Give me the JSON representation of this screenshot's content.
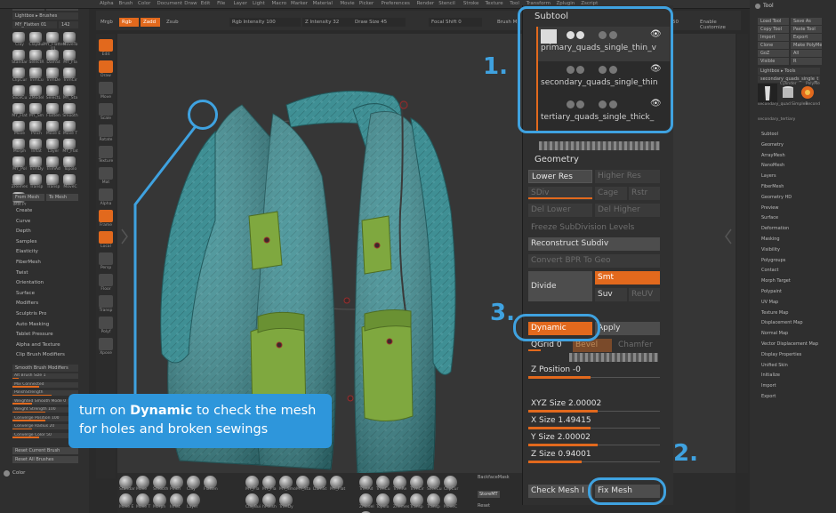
{
  "menu": [
    "Alpha",
    "Brush",
    "Color",
    "Document",
    "Draw",
    "Edit",
    "File",
    "Layer",
    "Light",
    "Macro",
    "Marker",
    "Material",
    "Movie",
    "Picker",
    "Preferences",
    "Render",
    "Stencil",
    "Stroke",
    "Texture",
    "Tool",
    "Transform",
    "Zplugin",
    "Zscript"
  ],
  "params": {
    "mrgb": "Mrgb",
    "rgb": "Rgb",
    "zadd": "Zadd",
    "zsub": "Zsub",
    "rgb_intensity": "Rgb Intensity 100",
    "z_intensity": "Z Intensity 32",
    "draw_size": "Draw Size 45",
    "focal_shift": "Focal Shift 0",
    "brush_label": "Brush M",
    "sculpt_label": "S",
    "active_points": "ActivePoints",
    "total_points": "TotalPoints",
    "sv": "SV 50",
    "enable_customize": "Enable Customize"
  },
  "left_panel": {
    "clone": "Clone",
    "selection": "Selection",
    "lightbox_brushes": "Lightbox ▸ Brushes",
    "current_brush": "MY_Flatten 01",
    "current_brush_num": "142",
    "brushes": [
      "Clay",
      "ClayBui",
      "MY_Flatten 01",
      "MoveTo",
      "Standar",
      "SelectR",
      "DamSt",
      "MY_Fla",
      "ClipCur",
      "TrimCu",
      "TrimDe",
      "TrimCir",
      "SliceCu",
      "ZModel",
      "SelectL",
      "MY_Sta",
      "MY_Flat",
      "MY_Sm",
      "Flatten",
      "Smooth",
      "Move",
      "Pinch",
      "Move E",
      "Move T",
      "Morph",
      "Inflat",
      "Layer",
      "MY_Flat",
      "MY_Pol",
      "TrimDy",
      "TrimAd",
      "Topolo",
      "ZRemes",
      "Transp",
      "Transp",
      "MoveC",
      "IMM Pr"
    ],
    "from_mesh": "From Mesh",
    "to_mesh": "To Mesh",
    "menus": [
      "Create",
      "Curve",
      "Depth",
      "Samples",
      "Elasticity",
      "FiberMesh",
      "Twist",
      "Orientation",
      "Surface",
      "Modifiers",
      "Sculptris Pro",
      "Auto Masking",
      "Tablet Pressure",
      "Alpha and Texture",
      "Clip Brush Modifiers"
    ],
    "smooth_mods_title": "Smooth Brush Modifiers",
    "sliders": [
      "Alt Brush Size 1",
      "Mix Connected",
      "PolishStrength",
      "Weighted Smooth Mode 0",
      "Weight Strength 100",
      "Converge Position 100",
      "Converge Radius 20",
      "Converge Color 50"
    ],
    "reset_current": "Reset Current Brush",
    "reset_all": "Reset All Brushes",
    "color_label": "Color"
  },
  "vtools": [
    "Edit",
    "Draw",
    "Move",
    "Scale",
    "Rotate",
    "Texture",
    "Mat",
    "Alpha",
    "Frame",
    "Local",
    "Persp",
    "Floor",
    "Transp",
    "Polyf",
    "Xpose"
  ],
  "bottom_brushes": [
    "Standar",
    "Move",
    "Smooth",
    "Pinch",
    "Clay",
    "Flatten",
    "Move E",
    "Move T",
    "Morph",
    "Inflat",
    "Layer",
    "MY_Fla",
    "MY_Fla",
    "MY_Smo",
    "MY_Sta",
    "DamSt",
    "MY_Flat",
    "ClayBui",
    "hPolish",
    "TrimDy",
    "TrimAd",
    "TrimCu",
    "TrimRe",
    "TrimCir",
    "SliceCu",
    "ClipCur",
    "ZModel",
    "Topolo",
    "ZRemes",
    "Transp",
    "Transp",
    "MoveC",
    "IMM Pr"
  ],
  "bottom_right": [
    "BackfaceMask",
    "StoreMT",
    "Reset"
  ],
  "right_panel": {
    "tool_title": "Tool",
    "buttons": [
      "Load Tool",
      "Save As",
      "Copy Tool",
      "Paste Tool",
      "Import",
      "Export",
      "Clone",
      "Make PolyMesh3D",
      "GoZ",
      "All",
      "Visible",
      "R"
    ],
    "lightbox_tools": "Lightbox ▸ Tools",
    "current_tool": "secondary_quads_single_t",
    "tools": [
      "secondary_quad",
      "Cylinder",
      "PolyMe",
      "SimpleB",
      "second",
      "second",
      "secondary_tertiary"
    ],
    "menus": [
      "Subtool",
      "Geometry",
      "ArrayMesh",
      "NanoMesh",
      "Layers",
      "FiberMesh",
      "Geometry HD",
      "Preview",
      "Surface",
      "Deformation",
      "Masking",
      "Visibility",
      "Polygroups",
      "Contact",
      "Morph Target",
      "Polypaint",
      "UV Map",
      "Texture Map",
      "Displacement Map",
      "Normal Map",
      "Vector Displacement Map",
      "Display Properties",
      "Unified Skin",
      "Initialize",
      "Import",
      "Export"
    ]
  },
  "subtool": {
    "title": "Subtool",
    "items": [
      {
        "name": "primary_quads_single_thin_v"
      },
      {
        "name": "secondary_quads_single_thin"
      },
      {
        "name": "tertiary_quads_single_thick_"
      }
    ]
  },
  "geometry": {
    "title": "Geometry",
    "lower_res": "Lower Res",
    "higher_res": "Higher Res",
    "sdiv": "SDiv",
    "cage": "Cage",
    "rstr": "Rstr",
    "del_lower": "Del Lower",
    "del_higher": "Del Higher",
    "freeze": "Freeze SubDivision Levels",
    "reconstruct": "Reconstruct Subdiv",
    "convert_bpr": "Convert BPR To Geo",
    "divide": "Divide",
    "smt": "Smt",
    "suv": "Suv",
    "reuv": "ReUV",
    "dynamic": "Dynamic",
    "apply": "Apply",
    "qgrid": "QGrid 0",
    "bevel": "Bevel",
    "chamfer": "Chamfer",
    "z_position": "Z Position -0",
    "xyz_size": "XYZ Size 2.00002",
    "x_size": "X Size 1.49415",
    "y_size": "Y Size 2.00002",
    "z_size": "Z Size 0.94001",
    "check_mesh": "Check Mesh I",
    "fix_mesh": "Fix Mesh"
  },
  "annotations": {
    "num1": "1.",
    "num2": "2.",
    "num3": "3.",
    "tip_pre": "turn on ",
    "tip_bold": "Dynamic",
    "tip_post": " to check the mesh for holes and broken sewings"
  },
  "colors": {
    "accent_orange": "#e2691d",
    "callout_blue": "#3fa2e0",
    "jacket_teal": "#3f8f94",
    "pocket_green": "#7fa83f"
  }
}
